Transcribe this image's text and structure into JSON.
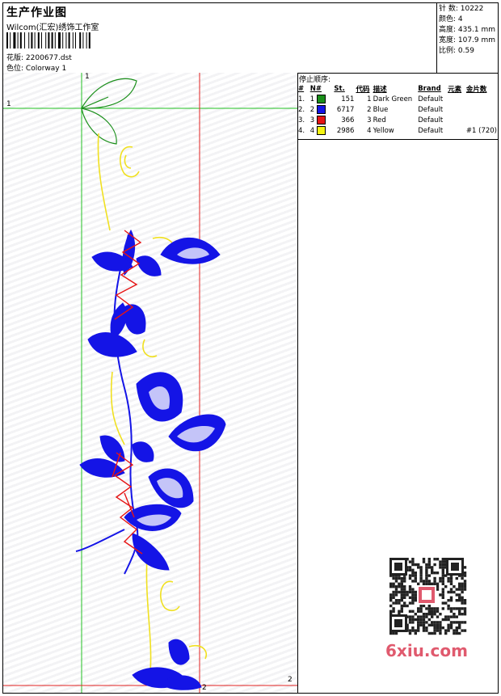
{
  "header": {
    "title": "生产作业图",
    "company": "Wilcom(汇宏)绣饰工作室",
    "design_label": "花版:",
    "design_value": "2200677.dst",
    "colorway_label": "色位:",
    "colorway_value": "Colorway 1"
  },
  "stats": {
    "stitches": "针 数: 10222",
    "colors": "颜色: 4",
    "height": "高度: 435.1 mm",
    "width": "宽度: 107.9 mm",
    "scale": "比例: 0.59"
  },
  "guides": {
    "green_label_top": "1",
    "green_label_left": "1",
    "red_label_bottom": "2",
    "red_label_right": "2"
  },
  "stop_sequence": {
    "title": "停止顺序:",
    "headers": [
      "#",
      "N#",
      "St.",
      "代码",
      "描述",
      "Brand",
      "元素",
      "金片数"
    ],
    "rows": [
      {
        "num": "1.",
        "n": "1",
        "color": "#1a8f1a",
        "st": "151",
        "code": "1",
        "desc": "Dark Green",
        "brand": "Default",
        "element": "",
        "sequin": ""
      },
      {
        "num": "2.",
        "n": "2",
        "color": "#1414e6",
        "st": "6717",
        "code": "2",
        "desc": "Blue",
        "brand": "Default",
        "element": "",
        "sequin": ""
      },
      {
        "num": "3.",
        "n": "3",
        "color": "#e61414",
        "st": "366",
        "code": "3",
        "desc": "Red",
        "brand": "Default",
        "element": "",
        "sequin": ""
      },
      {
        "num": "4.",
        "n": "4",
        "color": "#f5f514",
        "st": "2986",
        "code": "4",
        "desc": "Yellow",
        "brand": "Default",
        "element": "",
        "sequin": "#1 (720)"
      }
    ]
  },
  "watermark": {
    "logo_text": "6xiu.com"
  }
}
